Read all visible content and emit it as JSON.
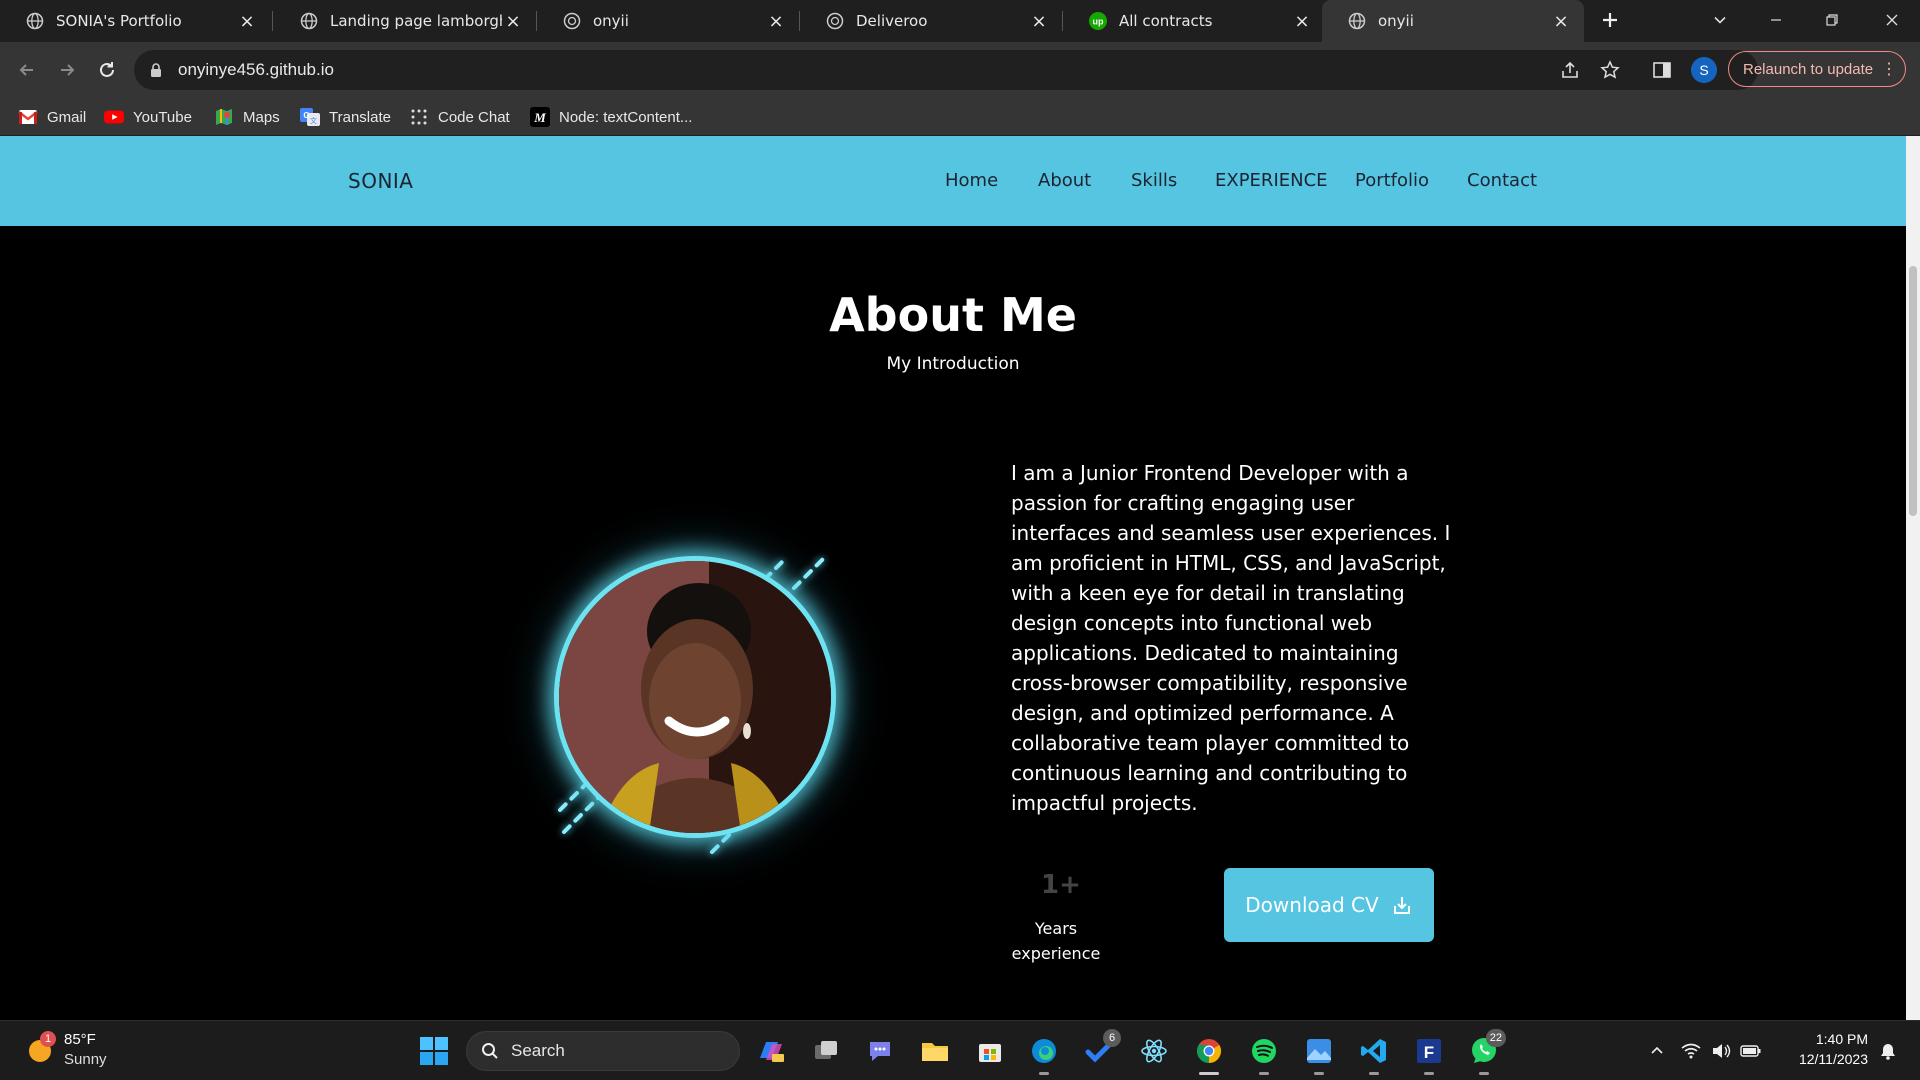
{
  "browser": {
    "tabs": [
      {
        "title": "SONIA's Portfolio",
        "icon": "globe-icon"
      },
      {
        "title": "Landing page lamborghini",
        "icon": "globe-icon"
      },
      {
        "title": "onyii",
        "icon": "globe-icon"
      },
      {
        "title": "Deliveroo",
        "icon": "globe-icon"
      },
      {
        "title": "All contracts",
        "icon": "upwork-icon"
      },
      {
        "title": "onyii",
        "icon": "globe-icon"
      }
    ],
    "active_tab": 5,
    "url": "onyinye456.github.io",
    "profile_initial": "S",
    "relaunch_label": "Relaunch to update",
    "bookmarks": [
      {
        "label": "Gmail",
        "icon": "gmail-icon"
      },
      {
        "label": "YouTube",
        "icon": "youtube-icon"
      },
      {
        "label": "Maps",
        "icon": "maps-icon"
      },
      {
        "label": "Translate",
        "icon": "translate-icon"
      },
      {
        "label": "Code Chat",
        "icon": "code-chat-icon"
      },
      {
        "label": "Node: textContent...",
        "icon": "mdn-icon"
      }
    ]
  },
  "site": {
    "brand": "SONIA",
    "nav": [
      "Home",
      "About",
      "Skills",
      "EXPERIENCE",
      "Portfolio",
      "Contact"
    ],
    "section_title": "About Me",
    "section_subtitle": "My Introduction",
    "bio": "I am a Junior Frontend Developer with a passion for crafting engaging user interfaces and seamless user experiences. I am proficient in HTML, CSS, and JavaScript, with a keen eye for detail in translating design concepts into functional web applications. Dedicated to maintaining cross-browser compatibility, responsive design, and optimized performance. A collaborative team player committed to continuous learning and contributing to impactful projects.",
    "stat_value": "1+",
    "stat_label": "Years experience",
    "cta_label": "Download CV",
    "accent": "#55c5e2"
  },
  "taskbar": {
    "weather_badge": "1",
    "temperature": "85°F",
    "condition": "Sunny",
    "search_label": "Search",
    "badges": {
      "todo": "6",
      "whatsapp": "22"
    },
    "time": "1:40 PM",
    "date": "12/11/2023"
  }
}
